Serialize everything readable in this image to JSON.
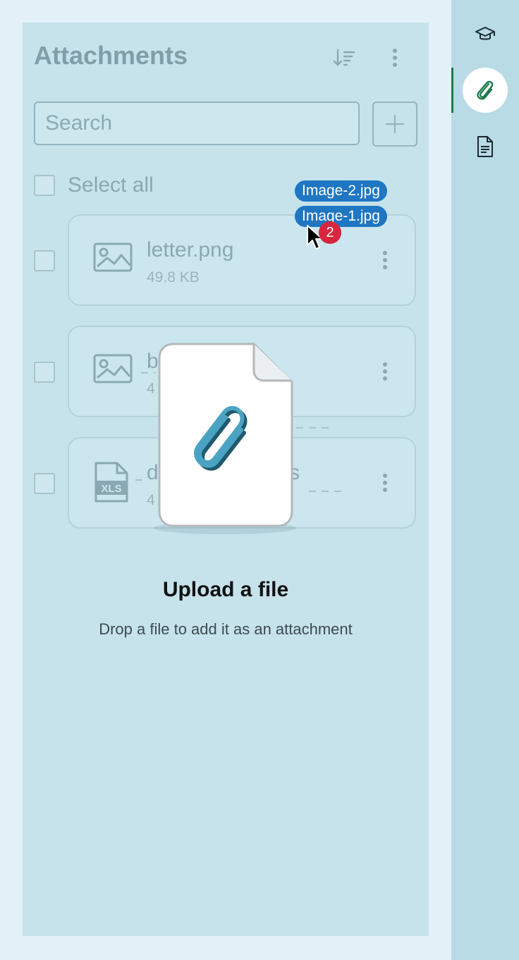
{
  "panel": {
    "title": "Attachments",
    "search": {
      "placeholder": "Search",
      "value": ""
    },
    "select_all_label": "Select all",
    "files": [
      {
        "name": "letter.png",
        "size": "49.8 KB",
        "icon": "image-file-icon"
      },
      {
        "name": "b",
        "size": "4",
        "icon": "image-file-icon"
      },
      {
        "name": "d",
        "name_tail": "s",
        "size": "4",
        "icon": "xls-file-icon"
      }
    ]
  },
  "drag": {
    "chips": [
      "Image-2.jpg",
      "Image-1.jpg"
    ],
    "count": "2"
  },
  "dropzone": {
    "title": "Upload a file",
    "subtitle": "Drop a file to add it as an attachment"
  },
  "rail": {
    "items": [
      {
        "icon": "graduation-cap-icon",
        "active": false
      },
      {
        "icon": "paperclip-icon",
        "active": true
      },
      {
        "icon": "document-icon",
        "active": false
      }
    ]
  },
  "colors": {
    "accent": "#1b7a4a",
    "chip": "#1f76c2",
    "badge": "#d7263d",
    "paperclip": "#4ba3c3"
  }
}
